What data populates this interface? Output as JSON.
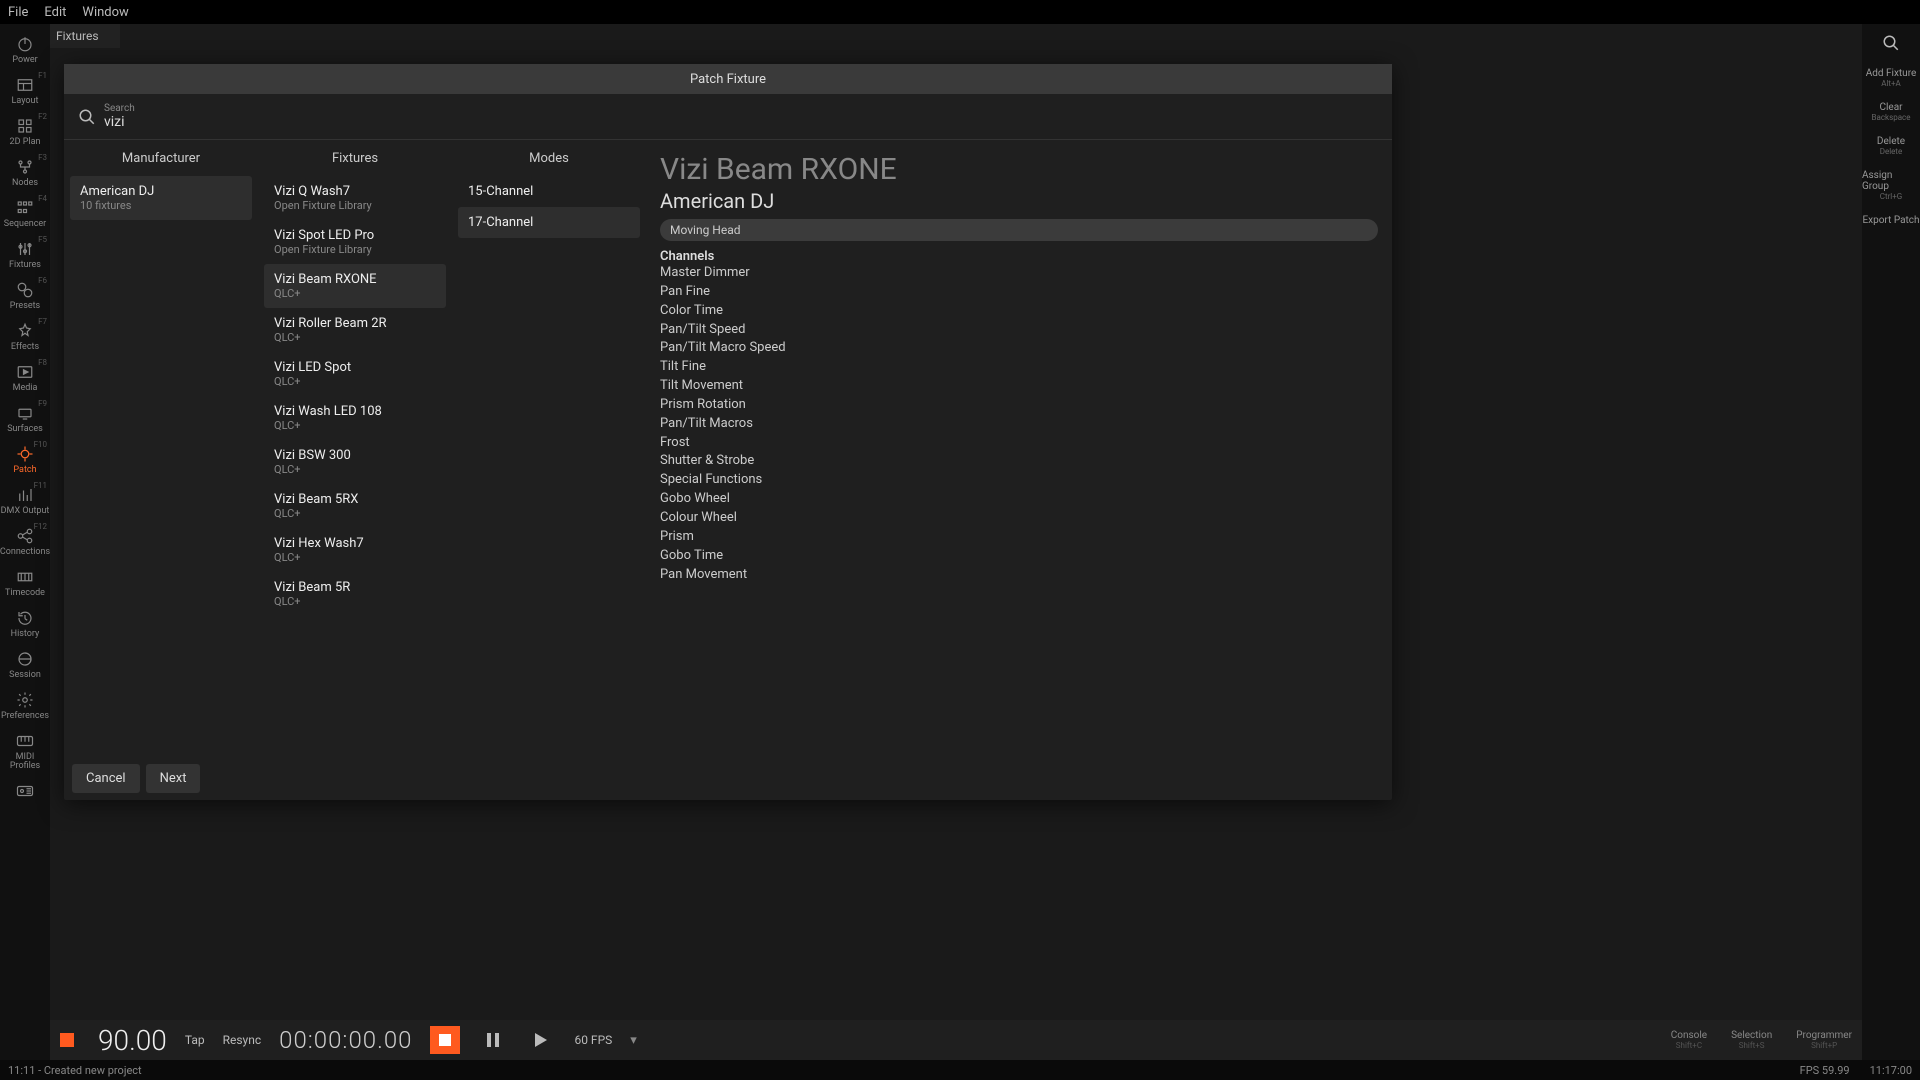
{
  "menubar": {
    "file": "File",
    "edit": "Edit",
    "window": "Window"
  },
  "maincol_tab": "Fixtures",
  "lsidebar": [
    {
      "fkey": "",
      "label": "Power",
      "icon": "power-icon"
    },
    {
      "fkey": "F1",
      "label": "Layout",
      "icon": "layout-icon"
    },
    {
      "fkey": "F2",
      "label": "2D Plan",
      "icon": "grid-icon"
    },
    {
      "fkey": "F3",
      "label": "Nodes",
      "icon": "nodes-icon"
    },
    {
      "fkey": "F4",
      "label": "Sequencer",
      "icon": "sequencer-icon"
    },
    {
      "fkey": "F5",
      "label": "Fixtures",
      "icon": "sliders-icon"
    },
    {
      "fkey": "F6",
      "label": "Presets",
      "icon": "presets-icon"
    },
    {
      "fkey": "F7",
      "label": "Effects",
      "icon": "effects-icon"
    },
    {
      "fkey": "F8",
      "label": "Media",
      "icon": "media-icon"
    },
    {
      "fkey": "F9",
      "label": "Surfaces",
      "icon": "surfaces-icon"
    },
    {
      "fkey": "F10",
      "label": "Patch",
      "icon": "patch-icon",
      "active": true
    },
    {
      "fkey": "F11",
      "label": "DMX Output",
      "icon": "bars-icon"
    },
    {
      "fkey": "F12",
      "label": "Connections",
      "icon": "connections-icon"
    },
    {
      "fkey": "",
      "label": "Timecode",
      "icon": "timecode-icon"
    },
    {
      "fkey": "",
      "label": "History",
      "icon": "history-icon"
    },
    {
      "fkey": "",
      "label": "Session",
      "icon": "session-icon"
    },
    {
      "fkey": "",
      "label": "Preferences",
      "icon": "gear-icon"
    },
    {
      "fkey": "",
      "label": "MIDI Profiles",
      "icon": "midi-icon",
      "small": true
    },
    {
      "fkey": "",
      "label": "",
      "icon": "osc-icon"
    }
  ],
  "rsidebar": {
    "search_icon": "search-icon",
    "items": [
      {
        "label": "Add Fixture",
        "sub": "Alt+A"
      },
      {
        "label": "Clear",
        "sub": "Backspace"
      },
      {
        "label": "Delete",
        "sub": "Delete"
      },
      {
        "label": "Assign Group",
        "sub": "Ctrl+G"
      },
      {
        "label": "Export Patch",
        "sub": ""
      }
    ]
  },
  "transport": {
    "bpm": "90.00",
    "tap": "Tap",
    "resync": "Resync",
    "timecode": "00:00:00.00",
    "fps_label": "60 FPS",
    "right": [
      {
        "label": "Console",
        "sub": "Shift+C"
      },
      {
        "label": "Selection",
        "sub": "Shift+S"
      },
      {
        "label": "Programmer",
        "sub": "Shift+P"
      }
    ]
  },
  "statusline": {
    "left": "11:11 - Created new project",
    "fps": "FPS 59.99",
    "clock": "11:17:00"
  },
  "dialog": {
    "title": "Patch Fixture",
    "search_label": "Search",
    "search_value": "vizi",
    "headers": {
      "manufacturer": "Manufacturer",
      "fixtures": "Fixtures",
      "modes": "Modes"
    },
    "manufacturers": [
      {
        "name": "American DJ",
        "sub": "10 fixtures",
        "selected": true
      }
    ],
    "fixtures": [
      {
        "name": "Vizi Q Wash7",
        "sub": "Open Fixture Library"
      },
      {
        "name": "Vizi Spot LED Pro",
        "sub": "Open Fixture Library"
      },
      {
        "name": "Vizi Beam RXONE",
        "sub": "QLC+",
        "selected": true
      },
      {
        "name": "Vizi Roller Beam 2R",
        "sub": "QLC+"
      },
      {
        "name": "Vizi LED Spot",
        "sub": "QLC+"
      },
      {
        "name": "Vizi Wash LED 108",
        "sub": "QLC+"
      },
      {
        "name": "Vizi BSW 300",
        "sub": "QLC+"
      },
      {
        "name": "Vizi Beam 5RX",
        "sub": "QLC+"
      },
      {
        "name": "Vizi Hex Wash7",
        "sub": "QLC+"
      },
      {
        "name": "Vizi Beam 5R",
        "sub": "QLC+"
      }
    ],
    "modes": [
      {
        "name": "15-Channel"
      },
      {
        "name": "17-Channel",
        "selected": true
      }
    ],
    "detail": {
      "title": "Vizi Beam RXONE",
      "manufacturer": "American DJ",
      "chip": "Moving Head",
      "channels_header": "Channels",
      "channels": [
        "Master Dimmer",
        "Pan Fine",
        "Color Time",
        "Pan/Tilt Speed",
        "Pan/Tilt Macro Speed",
        "Tilt Fine",
        "Tilt Movement",
        "Prism Rotation",
        "Pan/Tilt Macros",
        "Frost",
        "Shutter & Strobe",
        "Special Functions",
        "Gobo Wheel",
        "Colour Wheel",
        "Prism",
        "Gobo Time",
        "Pan Movement"
      ]
    },
    "footer": {
      "cancel": "Cancel",
      "next": "Next"
    }
  }
}
